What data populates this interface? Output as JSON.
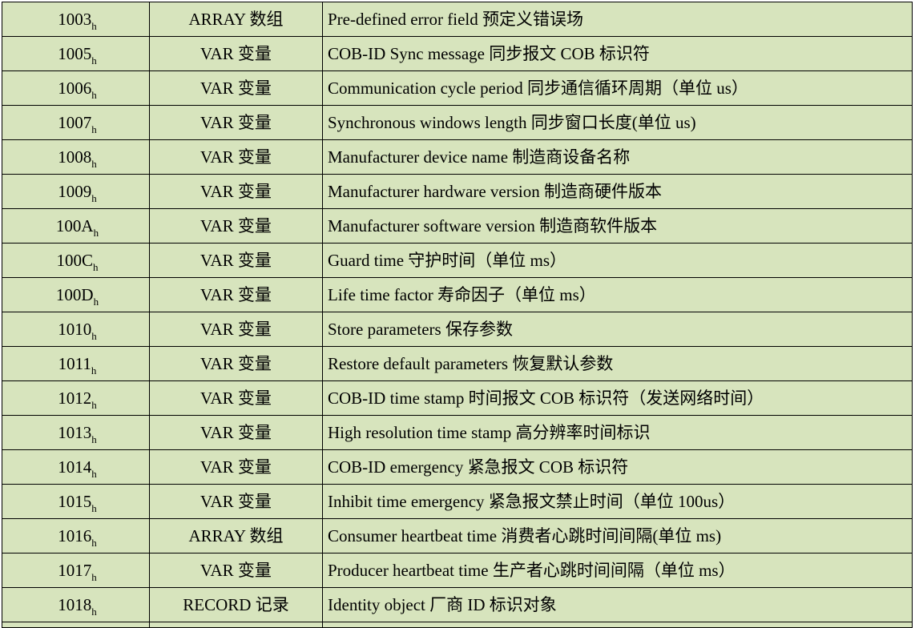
{
  "table": {
    "background_color": "#d7e4bd",
    "border_color": "#000000",
    "rows": [
      {
        "index": "1003",
        "sub": "h",
        "type": "ARRAY 数组",
        "description": "Pre-defined error field 预定义错误场"
      },
      {
        "index": "1005",
        "sub": "h",
        "type": "VAR 变量",
        "description": "COB-ID Sync message 同步报文 COB 标识符"
      },
      {
        "index": "1006",
        "sub": "h",
        "type": "VAR 变量",
        "description": "Communication cycle period 同步通信循环周期（单位 us）"
      },
      {
        "index": "1007",
        "sub": "h",
        "type": "VAR 变量",
        "description": "Synchronous windows length 同步窗口长度(单位 us)"
      },
      {
        "index": "1008",
        "sub": "h",
        "type": "VAR 变量",
        "description": "Manufacturer device name 制造商设备名称"
      },
      {
        "index": "1009",
        "sub": "h",
        "type": "VAR 变量",
        "description": "Manufacturer hardware version 制造商硬件版本"
      },
      {
        "index": "100A",
        "sub": "h",
        "type": "VAR 变量",
        "description": "Manufacturer software version 制造商软件版本"
      },
      {
        "index": "100C",
        "sub": "h",
        "type": "VAR 变量",
        "description": "Guard time 守护时间（单位 ms）"
      },
      {
        "index": "100D",
        "sub": "h",
        "type": "VAR 变量",
        "description": "Life time factor 寿命因子（单位 ms）"
      },
      {
        "index": "1010",
        "sub": "h",
        "type": "VAR 变量",
        "description": "Store parameters 保存参数"
      },
      {
        "index": "1011",
        "sub": "h",
        "type": "VAR 变量",
        "description": "Restore default parameters 恢复默认参数"
      },
      {
        "index": "1012",
        "sub": "h",
        "type": "VAR 变量",
        "description": "COB-ID time stamp 时间报文 COB 标识符（发送网络时间）"
      },
      {
        "index": "1013",
        "sub": "h",
        "type": "VAR 变量",
        "description": "High resolution time stamp 高分辨率时间标识"
      },
      {
        "index": "1014",
        "sub": "h",
        "type": "VAR 变量",
        "description": "COB-ID emergency 紧急报文 COB 标识符"
      },
      {
        "index": "1015",
        "sub": "h",
        "type": "VAR 变量",
        "description": "Inhibit time emergency 紧急报文禁止时间（单位 100us）"
      },
      {
        "index": "1016",
        "sub": "h",
        "type": "ARRAY 数组",
        "description": "Consumer heartbeat time 消费者心跳时间间隔(单位 ms)"
      },
      {
        "index": "1017",
        "sub": "h",
        "type": "VAR 变量",
        "description": "Producer heartbeat time 生产者心跳时间间隔（单位 ms）"
      },
      {
        "index": "1018",
        "sub": "h",
        "type": "RECORD 记录",
        "description": "Identity object 厂商 ID 标识对象"
      }
    ]
  }
}
